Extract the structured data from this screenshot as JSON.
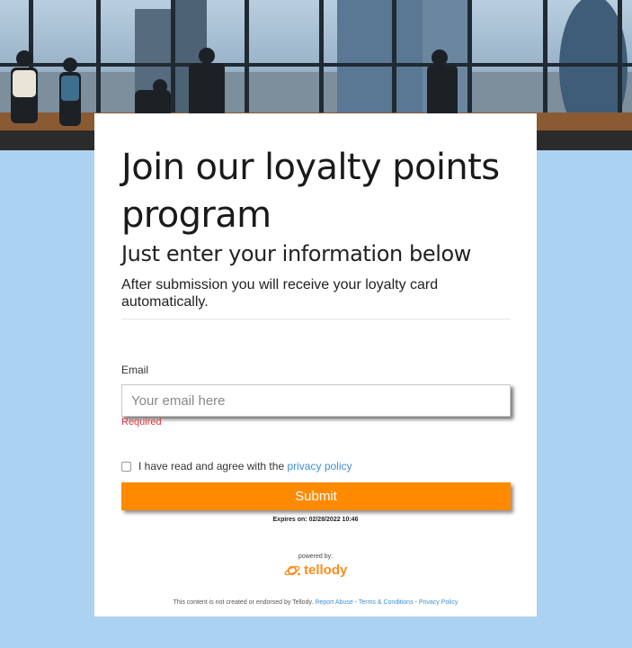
{
  "hero": {
    "image_alt": "Business people looking out of office windows at city skyline"
  },
  "form": {
    "title": "Join our loyalty points program",
    "subtitle": "Just enter your information below",
    "description": "After submission you will receive your loyalty card automatically.",
    "email": {
      "label": "Email",
      "placeholder": "Your email here",
      "value": "",
      "validation": "Required"
    },
    "consent": {
      "text": "I have read and agree with the",
      "link": "privacy policy",
      "checked": false
    },
    "submit_label": "Submit",
    "expires": "Expires on: 02/28/2022 10:46"
  },
  "branding": {
    "powered_by": "powered by:",
    "logo_text": "tellody",
    "logo_color": "#ff8c1a"
  },
  "footer": {
    "disclaimer": "This content is not created or endorsed by Tellody.",
    "report_abuse": "Report Abuse",
    "sep1": " - ",
    "terms": "Terms & Conditions",
    "sep2": " - ",
    "privacy": "Privacy Policy"
  },
  "colors": {
    "background": "#acd2f1",
    "accent": "#ff8a00",
    "link": "#3d8fd6",
    "error": "#e0383c"
  }
}
